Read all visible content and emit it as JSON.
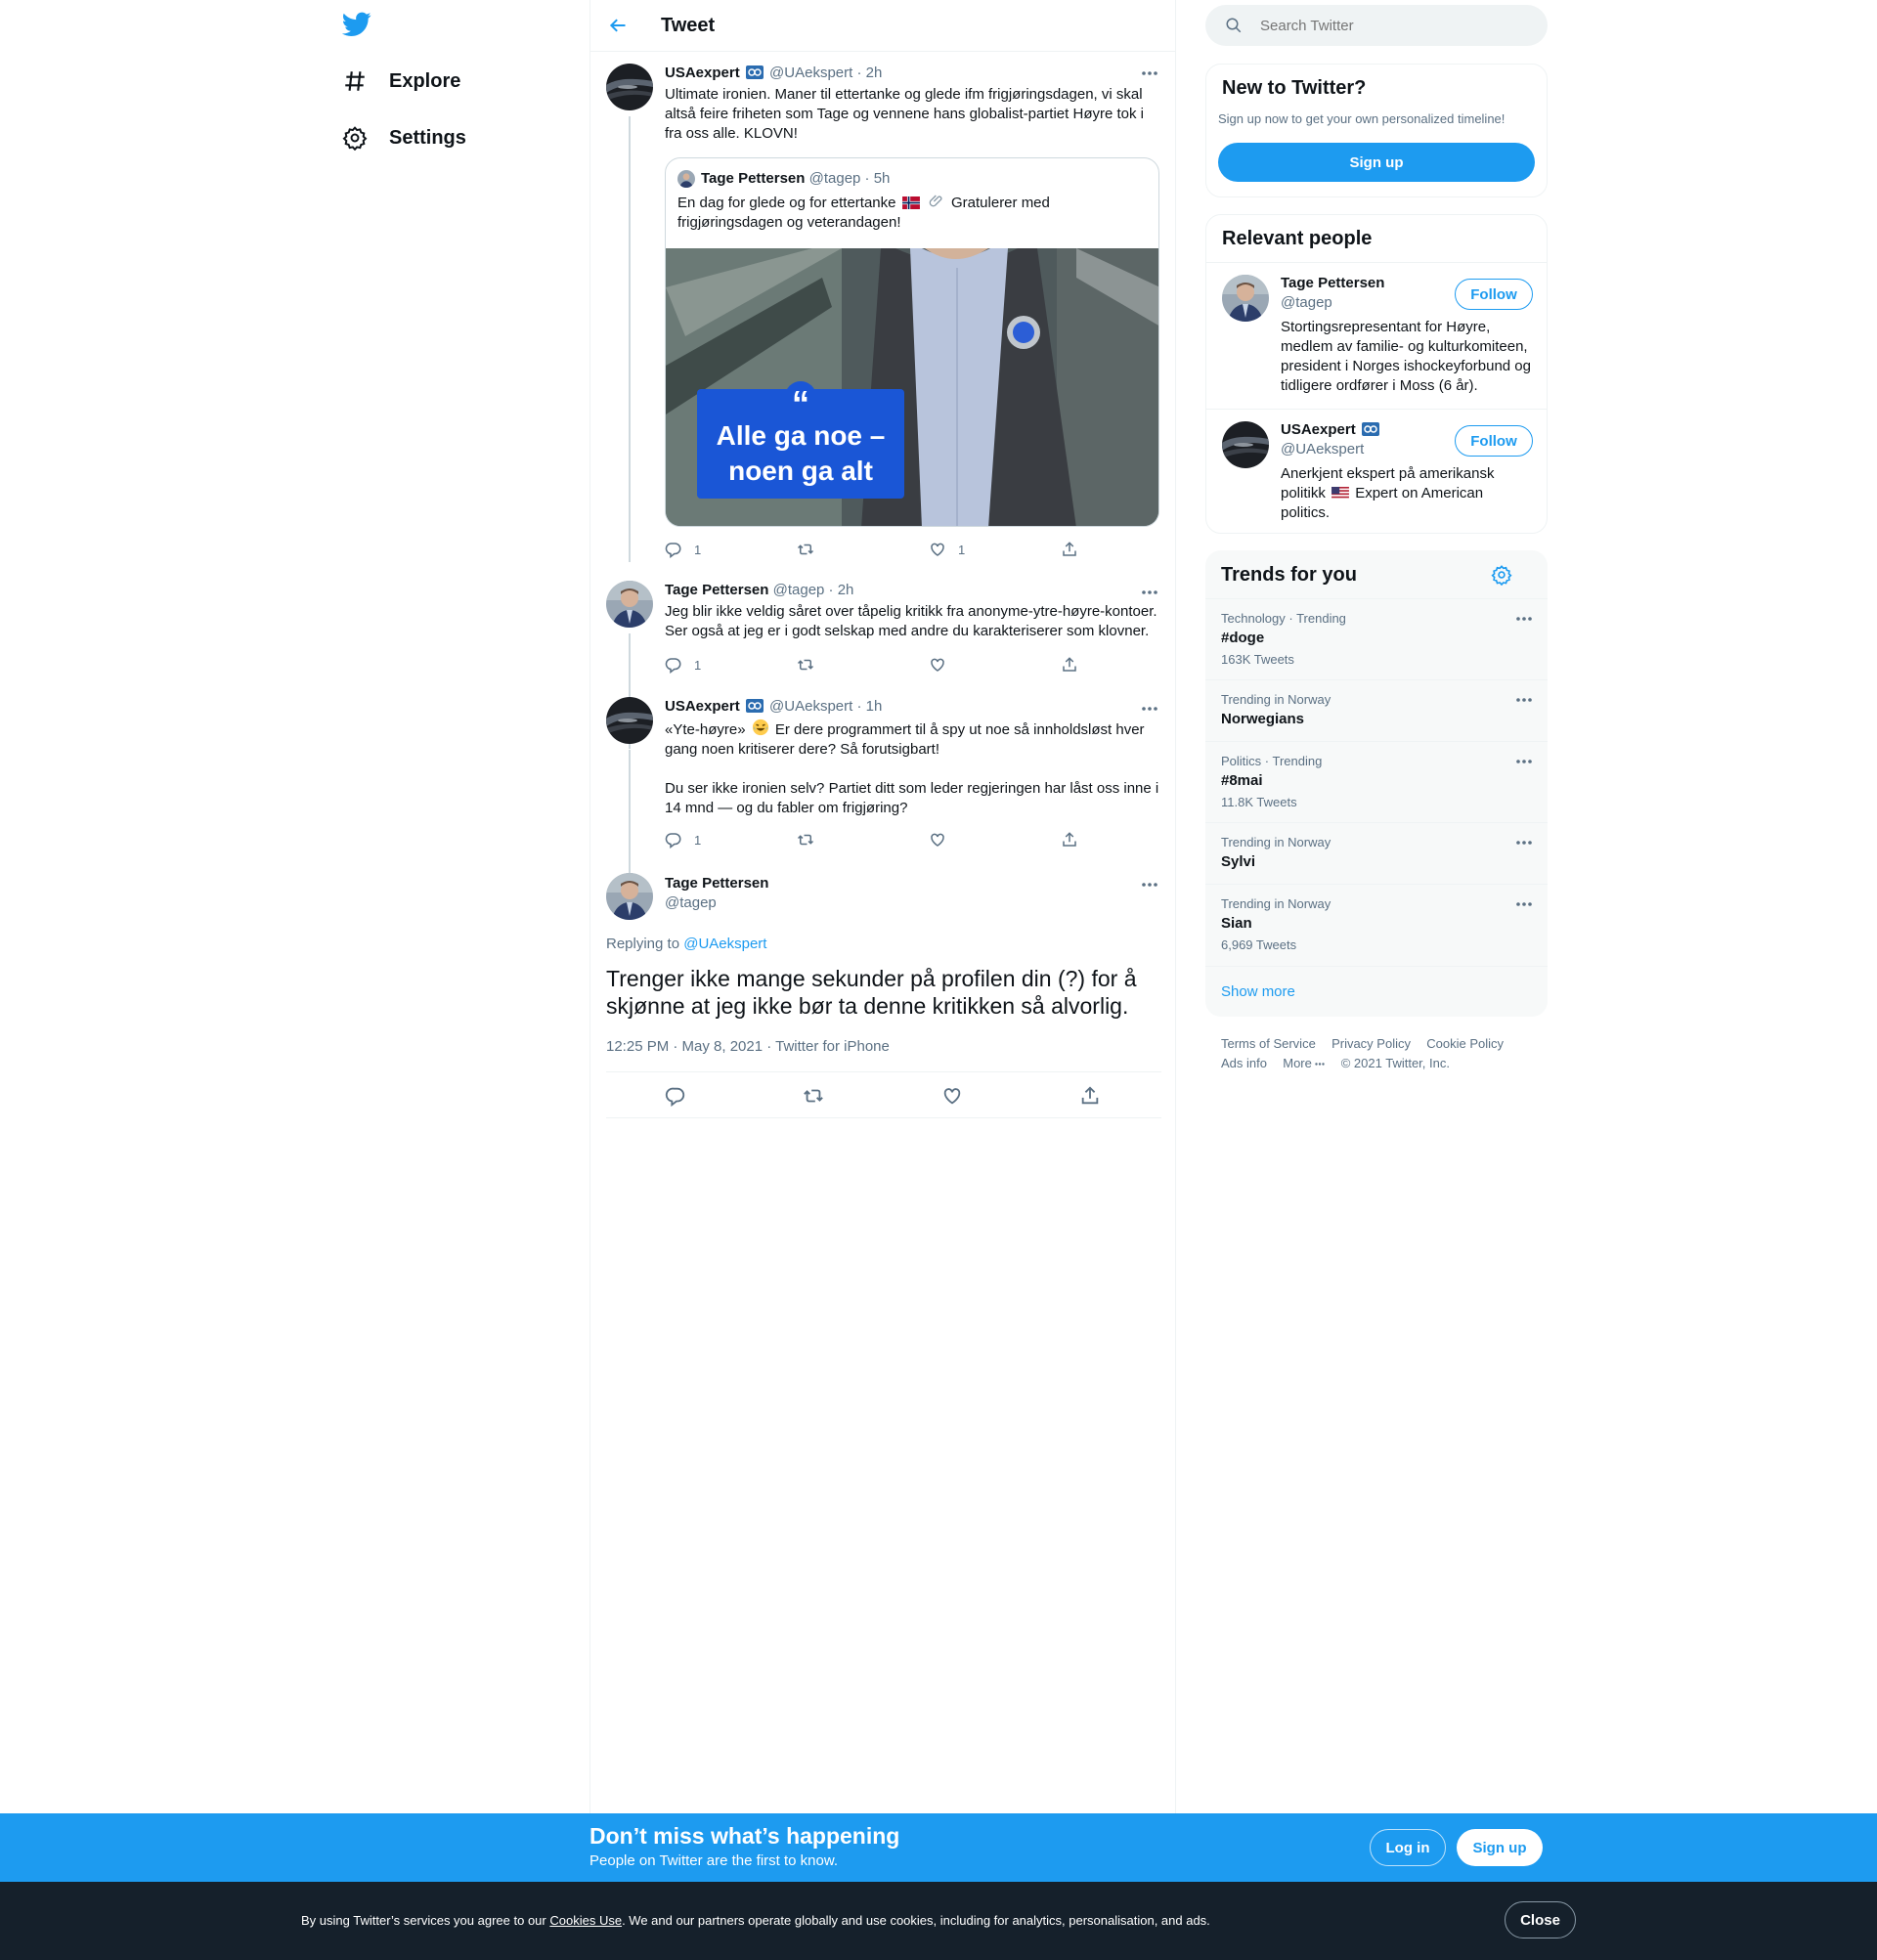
{
  "nav": {
    "explore_label": "Explore",
    "settings_label": "Settings"
  },
  "header": {
    "title": "Tweet"
  },
  "tweets": [
    {
      "name": "USAexpert",
      "handle": "@UAekspert",
      "time": "· 2h",
      "text": "Ultimate ironien. Maner til ettertanke og glede ifm frigjøringsdagen, vi skal altså feire friheten som Tage og vennene hans globalist-partiet Høyre tok i fra oss alle. KLOVN!",
      "replies": "1",
      "likes": "1",
      "quote": {
        "name": "Tage Pettersen",
        "handle": "@tagep",
        "time": "· 5h",
        "text_part1": "En dag for glede og for ettertanke",
        "text_part2": "Gratulerer med frigjøringsdagen og veterandagen!",
        "image_quote_mark": "“",
        "image_caption_line1": "Alle ga noe –",
        "image_caption_line2": "noen ga alt"
      }
    },
    {
      "name": "Tage Pettersen",
      "handle": "@tagep",
      "time": "· 2h",
      "text": "Jeg blir ikke veldig såret over tåpelig kritikk fra anonyme-ytre-høyre-kontoer. Ser også at jeg er i godt selskap med andre du karakteriserer som klovner.",
      "replies": "1"
    },
    {
      "name": "USAexpert",
      "handle": "@UAekspert",
      "time": "· 1h",
      "text_part1": "«Yte-høyre»",
      "text_part2": "Er dere programmert til å spy ut noe så innholdsløst hver gang noen kritiserer dere? Så forutsigbart!",
      "text_para2": "Du ser ikke ironien selv? Partiet ditt som leder regjeringen har låst oss inne i 14 mnd — og du fabler om frigjøring?",
      "replies": "1"
    }
  ],
  "main_tweet": {
    "name": "Tage Pettersen",
    "handle": "@tagep",
    "replying_prefix": "Replying to",
    "replying_handle": "@UAekspert",
    "text": "Trenger ikke mange sekunder på profilen din (?) for å skjønne at jeg ikke bør ta denne kritikken så alvorlig.",
    "meta": "12:25 PM · May 8, 2021 · Twitter for iPhone"
  },
  "search": {
    "placeholder": "Search Twitter"
  },
  "new_to_twitter": {
    "title": "New to Twitter?",
    "subtitle": "Sign up now to get your own personalized timeline!",
    "button": "Sign up"
  },
  "relevant_people": {
    "title": "Relevant people",
    "people": [
      {
        "name": "Tage Pettersen",
        "handle": "@tagep",
        "bio": "Stortingsrepresentant for Høyre, medlem av familie- og kulturkomiteen, president i Norges ishockeyforbund og tidligere ordfører i Moss (6 år).",
        "button": "Follow"
      },
      {
        "name": "USAexpert",
        "handle": "@UAekspert",
        "bio_part1": "Anerkjent ekspert på amerikansk politikk",
        "bio_part2": "Expert on American politics.",
        "button": "Follow"
      }
    ]
  },
  "trends": {
    "title": "Trends for you",
    "items": [
      {
        "context": "Technology · Trending",
        "name": "#doge",
        "count": "163K Tweets"
      },
      {
        "context": "Trending in Norway",
        "name": "Norwegians",
        "count": ""
      },
      {
        "context": "Politics · Trending",
        "name": "#8mai",
        "count": "11.8K Tweets"
      },
      {
        "context": "Trending in Norway",
        "name": "Sylvi",
        "count": ""
      },
      {
        "context": "Trending in Norway",
        "name": "Sian",
        "count": "6,969 Tweets"
      }
    ],
    "show_more": "Show more"
  },
  "footer": {
    "links": [
      "Terms of Service",
      "Privacy Policy",
      "Cookie Policy",
      "Ads info",
      "More"
    ],
    "copyright": "© 2021 Twitter, Inc."
  },
  "signup_bar": {
    "title": "Don’t miss what’s happening",
    "subtitle": "People on Twitter are the first to know.",
    "login": "Log in",
    "signup": "Sign up"
  },
  "cookie_bar": {
    "text_before": "By using Twitter’s services you agree to our",
    "link": "Cookies Use",
    "text_after": ". We and our partners operate globally and use cookies, including for analytics, personalisation, and ads.",
    "close": "Close"
  },
  "colors": {
    "brand": "#1d9bf0",
    "secondary_text": "#5b7083",
    "cookie_bg": "#15202b",
    "caption_box": "#1a56d6"
  }
}
